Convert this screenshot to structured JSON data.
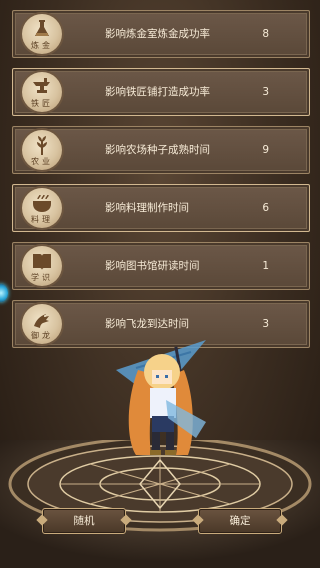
{
  "attributes": [
    {
      "emblem_icon": "alchemy-flask-icon",
      "emblem_text": "炼金",
      "label": "影响炼金室炼金成功率",
      "value": "8"
    },
    {
      "emblem_icon": "anvil-icon",
      "emblem_text": "铁匠",
      "label": "影响铁匠铺打造成功率",
      "value": "3"
    },
    {
      "emblem_icon": "wheat-icon",
      "emblem_text": "农业",
      "label": "影响农场种子成熟时间",
      "value": "9"
    },
    {
      "emblem_icon": "cooking-pot-icon",
      "emblem_text": "料理",
      "label": "影响料理制作时间",
      "value": "6"
    },
    {
      "emblem_icon": "book-icon",
      "emblem_text": "学识",
      "label": "影响图书馆研读时间",
      "value": "1"
    },
    {
      "emblem_icon": "dragon-icon",
      "emblem_text": "御龙",
      "label": "影响飞龙到达时间",
      "value": "3"
    }
  ],
  "buttons": {
    "random": "随机",
    "confirm": "确定"
  }
}
